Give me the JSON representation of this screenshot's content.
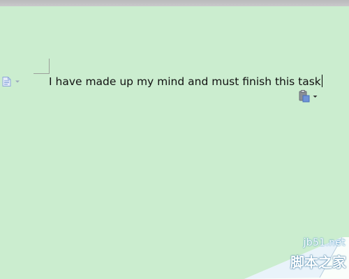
{
  "document": {
    "text": "I have made up my mind and must finish this task"
  },
  "icons": {
    "left_margin": "document-icon",
    "paste_options": "paste-clipboard-icon"
  },
  "colors": {
    "page_background": "#cbedcf",
    "text": "#111111",
    "icon_blue": "#7d9bd6",
    "watermark": "#ffffff"
  },
  "watermark": {
    "domain": "jb51.net",
    "brand": "脚本之家"
  }
}
